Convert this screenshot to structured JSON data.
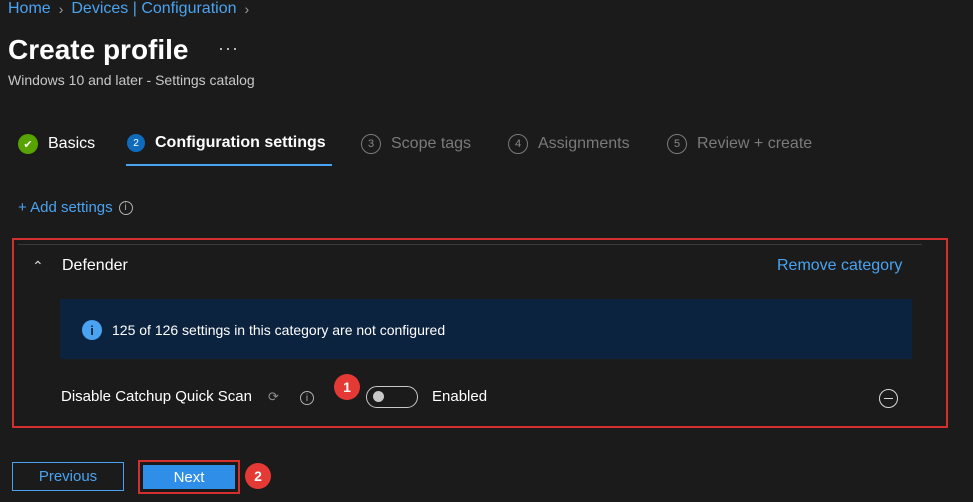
{
  "breadcrumb": {
    "home": "Home",
    "devices": "Devices | Configuration"
  },
  "header": {
    "title": "Create profile",
    "more": "···",
    "subtitle": "Windows 10 and later - Settings catalog"
  },
  "steps": [
    {
      "label": "Basics",
      "state": "done",
      "icon": "✔"
    },
    {
      "label": "Configuration settings",
      "state": "current",
      "number": "2"
    },
    {
      "label": "Scope tags",
      "state": "future",
      "number": "3"
    },
    {
      "label": "Assignments",
      "state": "future",
      "number": "4"
    },
    {
      "label": "Review + create",
      "state": "future",
      "number": "5"
    }
  ],
  "add_settings": {
    "label": "+ Add settings",
    "info_icon": "i"
  },
  "category": {
    "chevron": "⌃",
    "title": "Defender",
    "remove_label": "Remove category",
    "banner_icon": "i",
    "banner_text": "125 of 126 settings in this category are not configured",
    "setting": {
      "name": "Disable Catchup Quick Scan",
      "sync_icon": "⟳",
      "info_icon": "i",
      "toggle_value": "Enabled",
      "toggle_on": false
    }
  },
  "annotations": {
    "badge1": "1",
    "badge2": "2"
  },
  "footer": {
    "previous": "Previous",
    "next": "Next"
  },
  "colors": {
    "accent": "#4aa3f0",
    "highlight": "#d32f2f",
    "done": "#57a300",
    "banner": "#0c2340"
  }
}
